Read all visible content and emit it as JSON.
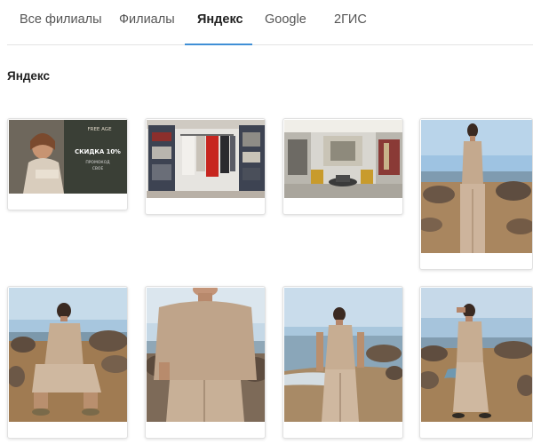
{
  "tabs": [
    {
      "label": "Все филиалы",
      "active": false
    },
    {
      "label": "Филиалы",
      "active": false
    },
    {
      "label": "Яндекс",
      "active": true
    },
    {
      "label": "Google",
      "active": false
    },
    {
      "label": "2ГИС",
      "active": false
    }
  ],
  "section": {
    "title": "Яндекс"
  },
  "banner": {
    "brand": "FREE AGE",
    "headline": "СКИДКА 10%",
    "line1": "ПРОМОКОД",
    "line2": "СВОЕ"
  },
  "colors": {
    "accent": "#3f8fd6",
    "tab_border": "#e3e3e3"
  },
  "photos": [
    {
      "name": "photo-promo-banner",
      "subject": "promo-banner"
    },
    {
      "name": "photo-store-rack",
      "subject": "store-interior"
    },
    {
      "name": "photo-store-hall",
      "subject": "store-interior"
    },
    {
      "name": "photo-model-seaside-standing",
      "subject": "model-on-beach"
    },
    {
      "name": "photo-model-seaside-sitting",
      "subject": "model-on-beach"
    },
    {
      "name": "photo-model-closeup",
      "subject": "model-on-beach"
    },
    {
      "name": "photo-model-shore-walk",
      "subject": "model-on-beach"
    },
    {
      "name": "photo-model-rocks",
      "subject": "model-on-beach"
    }
  ]
}
